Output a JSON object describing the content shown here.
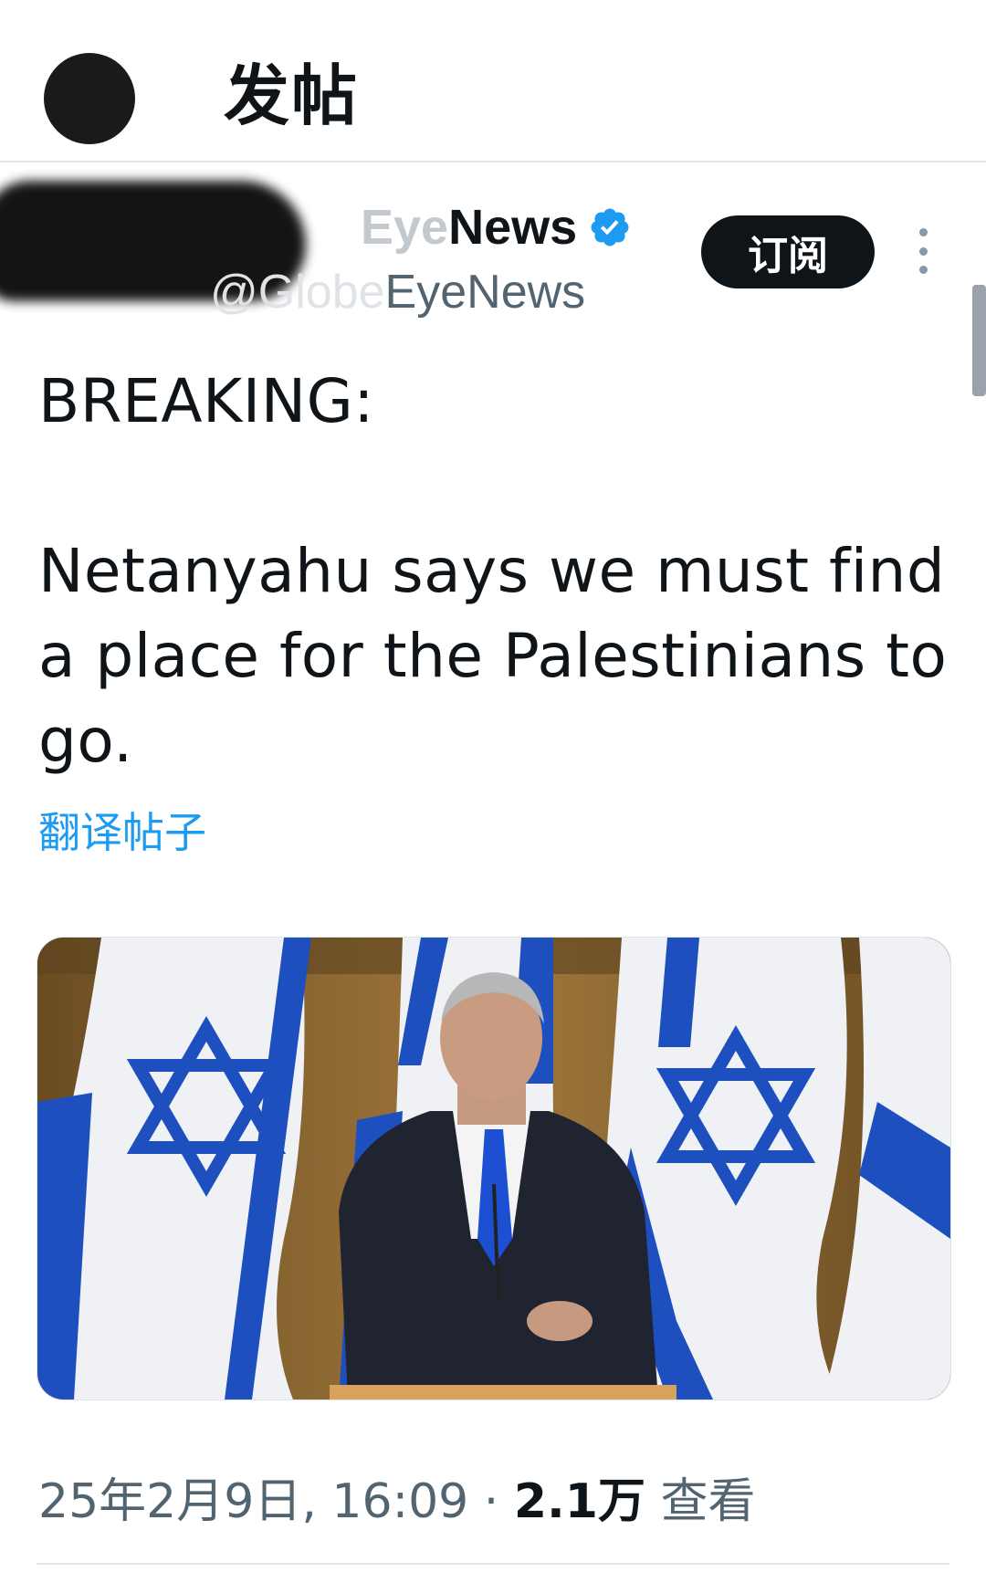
{
  "header": {
    "title": "发帖",
    "back_icon": "arrow-left-icon"
  },
  "author": {
    "display_name_visible": "News",
    "display_name_faded": "Eye ",
    "handle_faded": "@Globe",
    "handle_visible": "EyeNews",
    "verified_icon": "verified-badge-icon",
    "verified_color": "#1d9bf0",
    "subscribe_label": "订阅",
    "more_icon": "more-vertical-icon"
  },
  "tweet": {
    "line1": "BREAKING:",
    "line2": "Netanyahu says we must find a place for the Palestinians to go.",
    "translate_label": "翻译帖子"
  },
  "media": {
    "image_icon": "photo-image"
  },
  "meta": {
    "date_time": "25年2月9日, 16:09",
    "separator": "·",
    "views_count": "2.1万",
    "views_label": "查看"
  },
  "colors": {
    "accent": "#1d9bf0",
    "text_primary": "#0f1419",
    "text_secondary": "#536471",
    "divider": "#e1e5e9"
  }
}
